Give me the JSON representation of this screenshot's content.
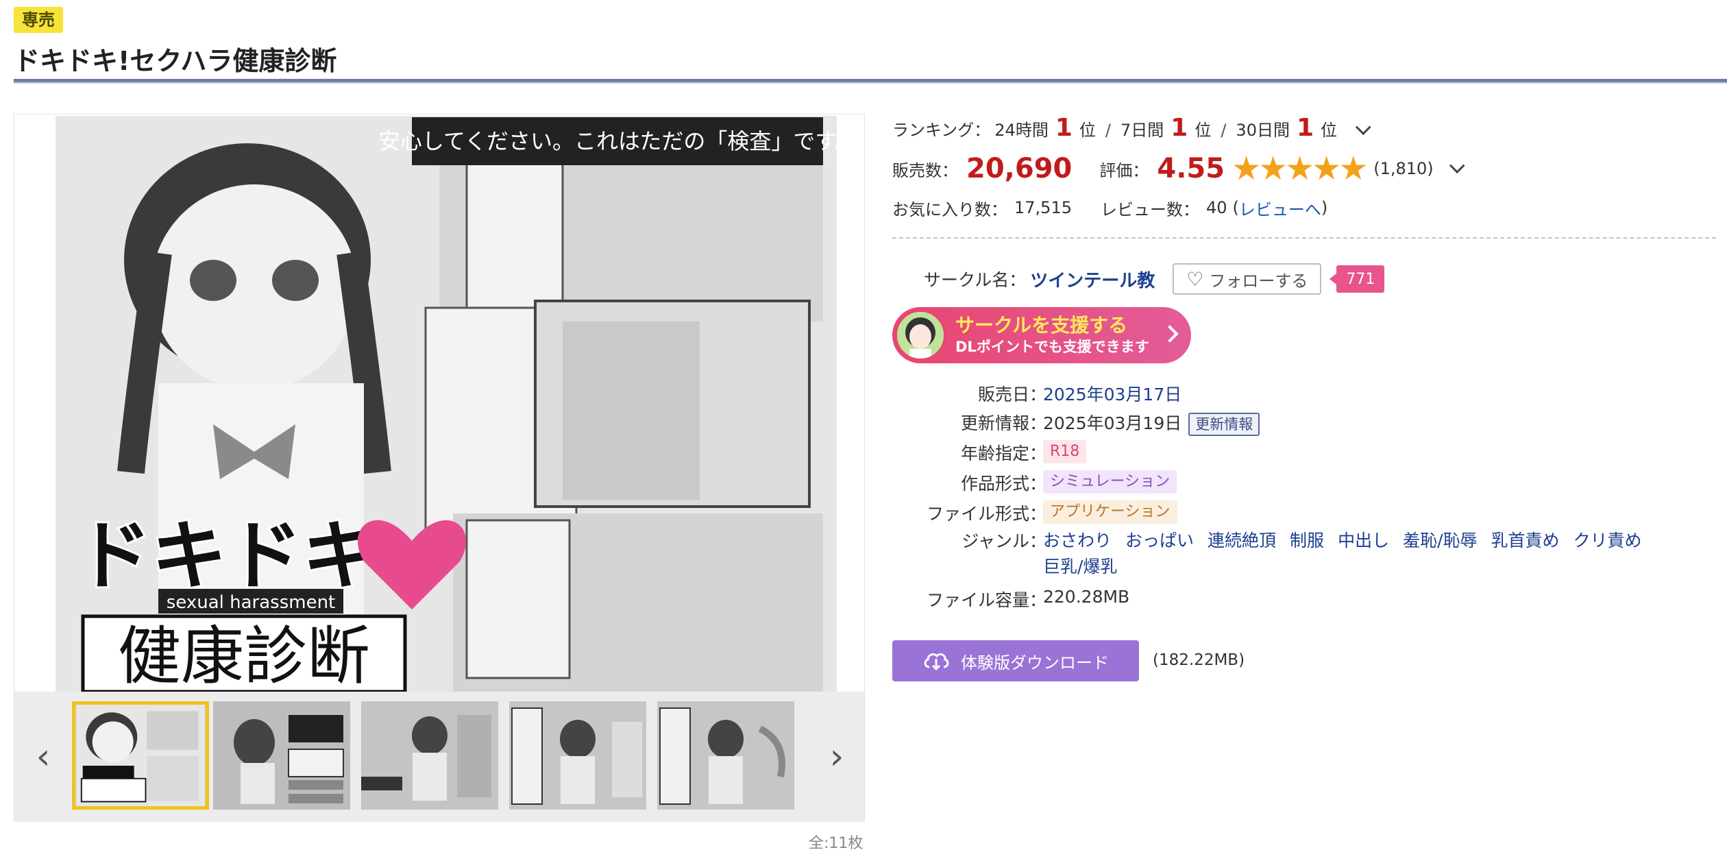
{
  "badge": "専売",
  "title": "ドキドキ!セクハラ健康診断",
  "gallery": {
    "main_text_banner": "安心してください。これはただの「検査」です。",
    "main_logo_top": "ドキドキ",
    "main_logo_sub": "sexual harassment",
    "main_logo_bottom": "健康診断",
    "image_count": "全:11枚"
  },
  "ranking": {
    "label": "ランキング：",
    "p24_label": "24時間",
    "p24_rank": "1",
    "p7_label": "7日間",
    "p7_rank": "1",
    "p30_label": "30日間",
    "p30_rank": "1",
    "unit": "位",
    "separator": "/"
  },
  "sales": {
    "label": "販売数：",
    "value": "20,690",
    "rating_label": "評価：",
    "rating_value": "4.55",
    "rating_stars": 4.55,
    "rating_count": "(1,810)"
  },
  "favorites": {
    "label": "お気に入り数：",
    "value": "17,515",
    "review_label": "レビュー数：",
    "review_value": "40",
    "review_link": "レビューへ",
    "open_paren": "(",
    "close_paren": ")"
  },
  "circle": {
    "label": "サークル名：",
    "name": "ツインテール教",
    "follow_label": "フォローする",
    "follower_count": "771",
    "support_main": "サークルを支援する",
    "support_sub": "DLポイントでも支援できます"
  },
  "specs": {
    "release_label": "販売日",
    "release_value": "2025年03月17日",
    "update_label": "更新情報",
    "update_value": "2025年03月19日",
    "update_badge": "更新情報",
    "age_label": "年齢指定",
    "age_value": "R18",
    "work_format_label": "作品形式",
    "work_format_value": "シミュレーション",
    "file_format_label": "ファイル形式",
    "file_format_value": "アプリケーション",
    "genre_label": "ジャンル",
    "genres": [
      "おさわり",
      "おっぱい",
      "連続絶頂",
      "制服",
      "中出し",
      "羞恥/恥辱",
      "乳首責め",
      "クリ責め",
      "巨乳/爆乳"
    ],
    "size_label": "ファイル容量",
    "size_value": "220.28MB",
    "colon": "："
  },
  "trial": {
    "label": "体験版ダウンロード",
    "size": "(182.22MB)"
  },
  "colors": {
    "accent_red": "#c01b1b",
    "star": "#f2a21a",
    "support_pink": "#e8466f",
    "trial_purple": "#9a73d6",
    "link_blue": "#1c3f8f"
  }
}
